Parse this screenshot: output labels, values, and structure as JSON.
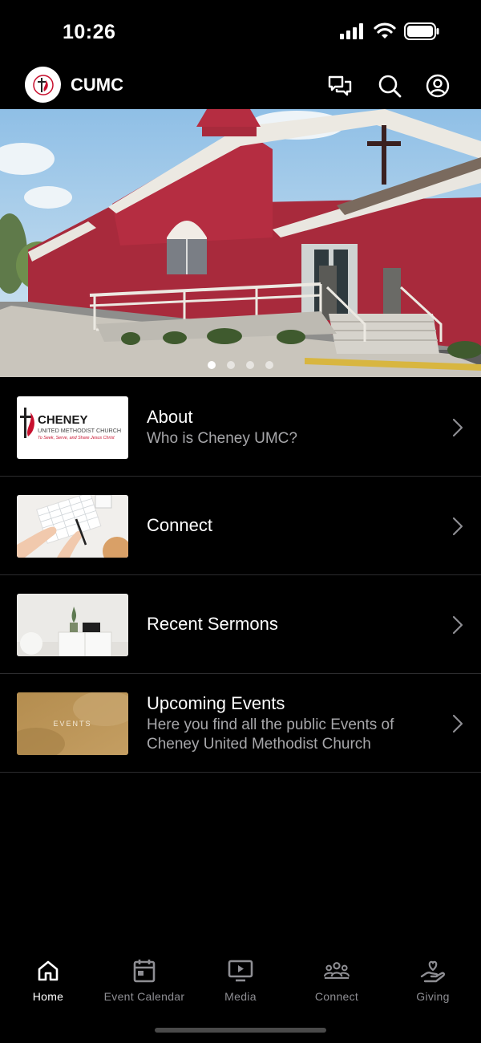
{
  "status_bar": {
    "time": "10:26"
  },
  "header": {
    "title": "CUMC",
    "icons": [
      "chat-icon",
      "search-icon",
      "profile-icon"
    ]
  },
  "hero": {
    "slides": 4,
    "active_slide": 1
  },
  "menu": [
    {
      "title": "About",
      "subtitle": "Who is Cheney UMC?",
      "thumb": "cheney-logo"
    },
    {
      "title": "Connect",
      "subtitle": "",
      "thumb": "hands-writing"
    },
    {
      "title": "Recent Sermons",
      "subtitle": "",
      "thumb": "white-room"
    },
    {
      "title": "Upcoming Events",
      "subtitle": "Here you find all the public Events of Cheney United Methodist Church",
      "thumb": "events"
    }
  ],
  "about_logo": {
    "name": "CHENEY",
    "church": "UNITED METHODIST CHURCH",
    "tagline": "To Seek, Serve, and Share Jesus Christ"
  },
  "events_thumb_text": "EVENTS",
  "tabs": [
    {
      "label": "Home",
      "icon": "home-icon",
      "active": true
    },
    {
      "label": "Event Calendar",
      "icon": "calendar-icon",
      "active": false
    },
    {
      "label": "Media",
      "icon": "media-icon",
      "active": false
    },
    {
      "label": "Connect",
      "icon": "group-icon",
      "active": false
    },
    {
      "label": "Giving",
      "icon": "giving-icon",
      "active": false
    }
  ],
  "colors": {
    "background": "#000000",
    "text_primary": "#ffffff",
    "text_secondary": "#a7a7aa",
    "tab_inactive": "#8e8e93",
    "divider": "#2c2c2e"
  }
}
